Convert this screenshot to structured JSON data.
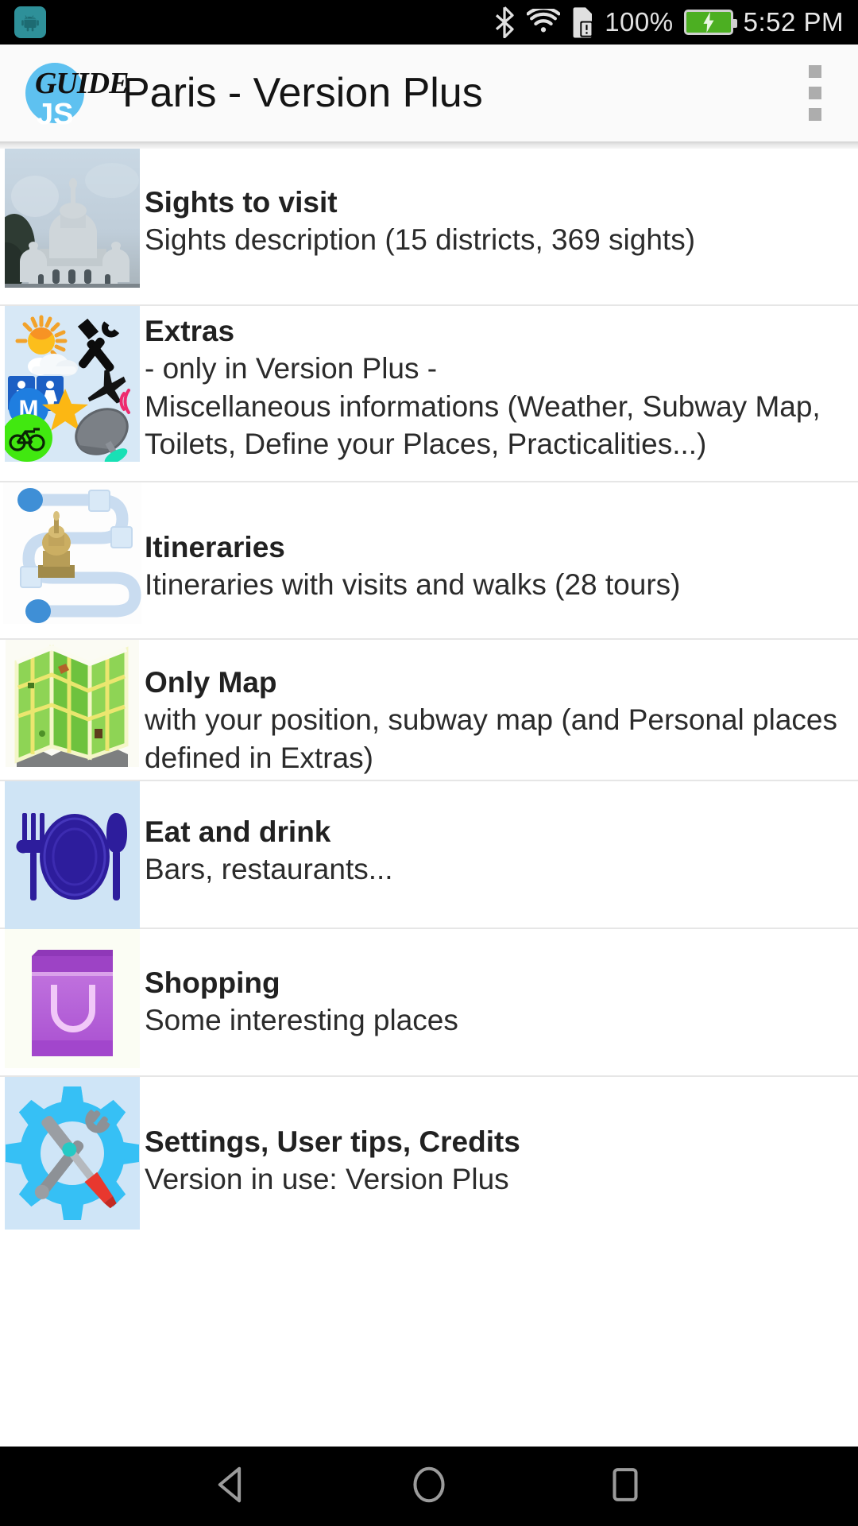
{
  "status_bar": {
    "notification_icon": "android-app-icon",
    "bluetooth_icon": "bluetooth-icon",
    "wifi_icon": "wifi-icon",
    "sim_icon": "sim-card-alert-icon",
    "battery_percent": "100%",
    "battery_icon": "battery-charging-icon",
    "clock": "5:52 PM"
  },
  "action_bar": {
    "logo_guide": "GUIDE",
    "logo_js": "JS",
    "title": "Paris - Version Plus",
    "overflow_icon": "overflow-menu-icon"
  },
  "list": {
    "items": [
      {
        "id": "sights-to-visit",
        "title": "Sights to visit",
        "desc": "Sights description (15 districts, 369 sights)",
        "thumb": "sacre-coeur-photo-thumbnail"
      },
      {
        "id": "extras",
        "title": "Extras",
        "desc": "- only in Version Plus -\nMiscellaneous informations (Weather, Subway Map, Toilets, Define your Places, Practicalities...)",
        "desc_line1": "- only in Version Plus -",
        "desc_line2": "Miscellaneous informations (Weather, Subway Map, Toilets, Define your Places, Practicalities...)",
        "thumb": "extras-collage-thumbnail"
      },
      {
        "id": "itineraries",
        "title": "Itineraries",
        "desc": "Itineraries with visits and walks (28 tours)",
        "thumb": "itinerary-route-thumbnail"
      },
      {
        "id": "only-map",
        "title": "Only Map",
        "desc": "with your position, subway map (and Personal places defined in Extras)",
        "thumb": "folded-map-thumbnail"
      },
      {
        "id": "eat-and-drink",
        "title": "Eat and drink",
        "desc": "Bars, restaurants...",
        "thumb": "cutlery-plate-thumbnail"
      },
      {
        "id": "shopping",
        "title": "Shopping",
        "desc": "Some interesting places",
        "thumb": "shopping-bag-thumbnail"
      },
      {
        "id": "settings-user-tips-credits",
        "title": "Settings, User tips, Credits",
        "desc": "Version in use: Version Plus",
        "thumb": "gear-tools-thumbnail"
      }
    ]
  },
  "nav_bar": {
    "back_icon": "back-triangle-icon",
    "home_icon": "home-circle-icon",
    "recents_icon": "recents-square-icon"
  },
  "colors": {
    "accent": "#5ec1f0",
    "status_bar_bg": "#000000",
    "action_bar_bg": "#fafafa",
    "battery_green": "#4caf22",
    "divider": "#e6e6e6",
    "title_text": "#212121"
  }
}
